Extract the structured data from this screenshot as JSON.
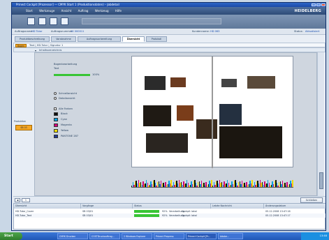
{
  "window": {
    "title": "Prinect Cockpit [Prozessor] — CMYK Start 1 (Produktionsdaten) – Jobdetail"
  },
  "menu": {
    "items": [
      "Start",
      "Werkzeuge",
      "Ansicht",
      "Auftrag",
      "Werkzeug",
      "Hilfe"
    ]
  },
  "brand": "HEIDELBERG",
  "toolbar": {
    "icons": [
      "layout-icon",
      "copy-icon",
      "tree-icon",
      "document-icon"
    ]
  },
  "job": {
    "auftrag_label": "Auftragsname:",
    "auftrag_value": "HD Tutor",
    "nummer_label": "Auftragsnummer:",
    "nummer_value": "10 000011",
    "kunde_label": "Kundenname:",
    "kunde_value": "HD 063",
    "status_label": "Status:",
    "status_value": "Aktualisiert"
  },
  "tabs": [
    "Produktbeschreibung",
    "Vorabnahme",
    "Auftragsvorbereitung",
    "Übersicht",
    "Protokoll"
  ],
  "active_tab": 3,
  "subbar": {
    "btn": "Bogen",
    "path": "Text | HD-Tutor | Signatur 1"
  },
  "panel_header": "Inhaltsverzeichnis",
  "left_strip": {
    "label": "Produktion",
    "badge": "SB 03"
  },
  "left_panel": {
    "section": "Bogenbearbeitung",
    "field_label": "Text",
    "progress_pct": "100%",
    "progress": 1.0,
    "opt1": "Schnellansicht",
    "opt2": "Detailansicht",
    "colors_header": "Alle Farben",
    "colors": [
      {
        "name": "Black",
        "hex": "#111111"
      },
      {
        "name": "Cyan",
        "hex": "#00a0e0"
      },
      {
        "name": "Magenta",
        "hex": "#d4007a"
      },
      {
        "name": "Yellow",
        "hex": "#f0e000"
      },
      {
        "name": "PANTONE 287",
        "hex": "#1f3a93"
      }
    ]
  },
  "bottom_tools": {
    "page": "1",
    "button": "Schließen"
  },
  "table": {
    "headers": [
      "Übersicht",
      "Vorgänge",
      "Status",
      "Letzte Nachricht",
      "Änderungsdatum"
    ],
    "rows": [
      {
        "name": "HD-Tutor_Cover",
        "job": "SB 03/01",
        "pct": "92%",
        "state": "Verarbeitung",
        "msg": "Cockpit lokal",
        "date": "05.12.2008 13:47:16"
      },
      {
        "name": "HD-Tutor_Text",
        "job": "SB 03/01",
        "pct": "92%",
        "state": "Verarbeitung",
        "msg": "Cockpit lokal",
        "date": "05.12.2008 13:47:17"
      }
    ]
  },
  "taskbar": {
    "start": "Start",
    "tasks": [
      "CMYK Drucken",
      "COSTDruckauftrag...",
      "2 Windows Explorer",
      "Prinect Prepress",
      "Prinect Cockpit [Pr...",
      "Adobe..."
    ],
    "clock": "13:48"
  }
}
